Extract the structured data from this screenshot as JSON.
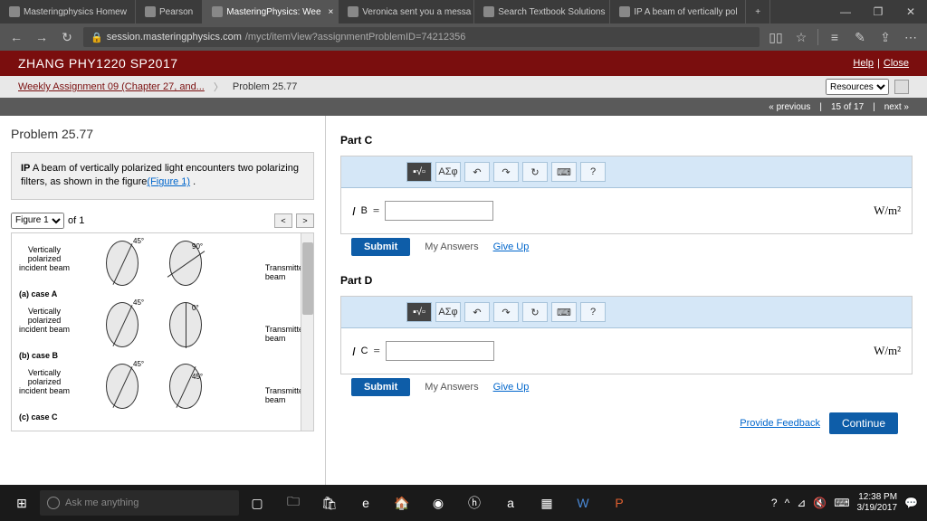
{
  "tabs": [
    {
      "label": "Masteringphysics Homew"
    },
    {
      "label": "Pearson"
    },
    {
      "label": "MasteringPhysics: Wee",
      "active": true
    },
    {
      "label": "Veronica sent you a messa"
    },
    {
      "label": "Search Textbook Solutions"
    },
    {
      "label": "IP A beam of vertically pol"
    }
  ],
  "url": {
    "host": "session.masteringphysics.com",
    "path": "/myct/itemView?assignmentProblemID=74212356"
  },
  "course": {
    "title": "ZHANG PHY1220 SP2017",
    "help": "Help",
    "close": "Close"
  },
  "breadcrumb": {
    "link": "Weekly Assignment 09 (Chapter 27, and...",
    "current": "Problem 25.77",
    "resources": "Resources"
  },
  "navbar": {
    "prev": "« previous",
    "pos": "15 of 17",
    "next": "next »"
  },
  "problem": {
    "title": "Problem 25.77",
    "desc_pre": "IP",
    "desc": " A beam of vertically polarized light encounters two polarizing filters, as shown in the figure",
    "fig_link": "(Figure 1)",
    "desc_post": " ."
  },
  "figure": {
    "select": "Figure 1",
    "of": "of 1",
    "cases": [
      {
        "label": "(a) case A",
        "a1": "45°",
        "a2": "90°"
      },
      {
        "label": "(b) case B",
        "a1": "45°",
        "a2": "0°"
      },
      {
        "label": "(c) case C",
        "a1": "45°",
        "a2": "45°"
      }
    ],
    "beam_label": "Vertically\npolarized\nincident beam",
    "trans_label": "Transmitted\nbeam"
  },
  "parts": [
    {
      "label": "Part C",
      "var": "I",
      "sub": "B",
      "unit": "W/m²"
    },
    {
      "label": "Part D",
      "var": "I",
      "sub": "C",
      "unit": "W/m²"
    }
  ],
  "buttons": {
    "submit": "Submit",
    "my_answers": "My Answers",
    "give_up": "Give Up",
    "feedback": "Provide Feedback",
    "continue": "Continue"
  },
  "tools": {
    "greek": "ΑΣφ",
    "help": "?"
  },
  "taskbar": {
    "cortana": "Ask me anything",
    "time": "12:38 PM",
    "date": "3/19/2017"
  }
}
